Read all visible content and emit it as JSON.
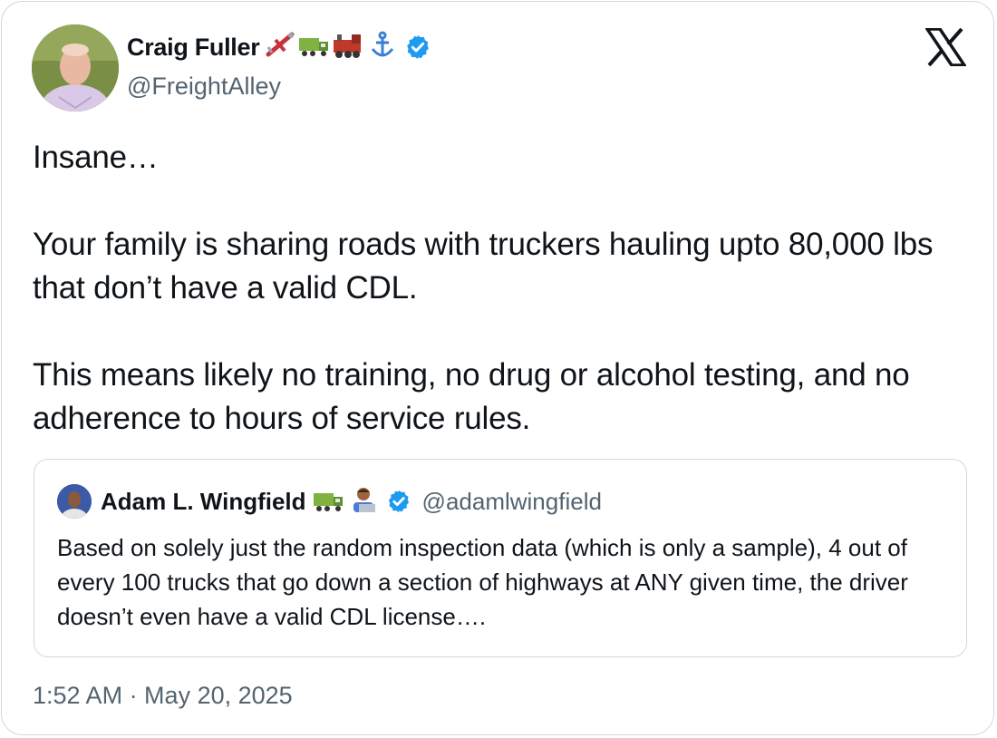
{
  "author": {
    "name": "Craig Fuller",
    "name_emojis": "✈🚛🚂⚓",
    "handle": "@FreightAlley",
    "verified": true
  },
  "platform_logo": "x-logo-icon",
  "tweet": {
    "lines": [
      "Insane…",
      "Your family is sharing roads with truckers hauling upto 80,000 lbs that don’t have a valid CDL.",
      "This means likely no training, no drug or alcohol testing, and no adherence to hours of service rules."
    ]
  },
  "quoted_tweet": {
    "name": "Adam L. Wingfield",
    "name_emojis": "🚛👨",
    "handle": "@adamlwingfield",
    "verified": true,
    "text": "Based on solely just the random inspection data (which is only a sample), 4 out of every 100 trucks that go down a section of highways at ANY given time, the driver doesn’t even have a valid CDL license…."
  },
  "timestamp": "1:52 AM · May 20, 2025",
  "colors": {
    "verified_blue": "#1d9bf0",
    "secondary_text": "#536471",
    "border": "#cfd9de"
  }
}
